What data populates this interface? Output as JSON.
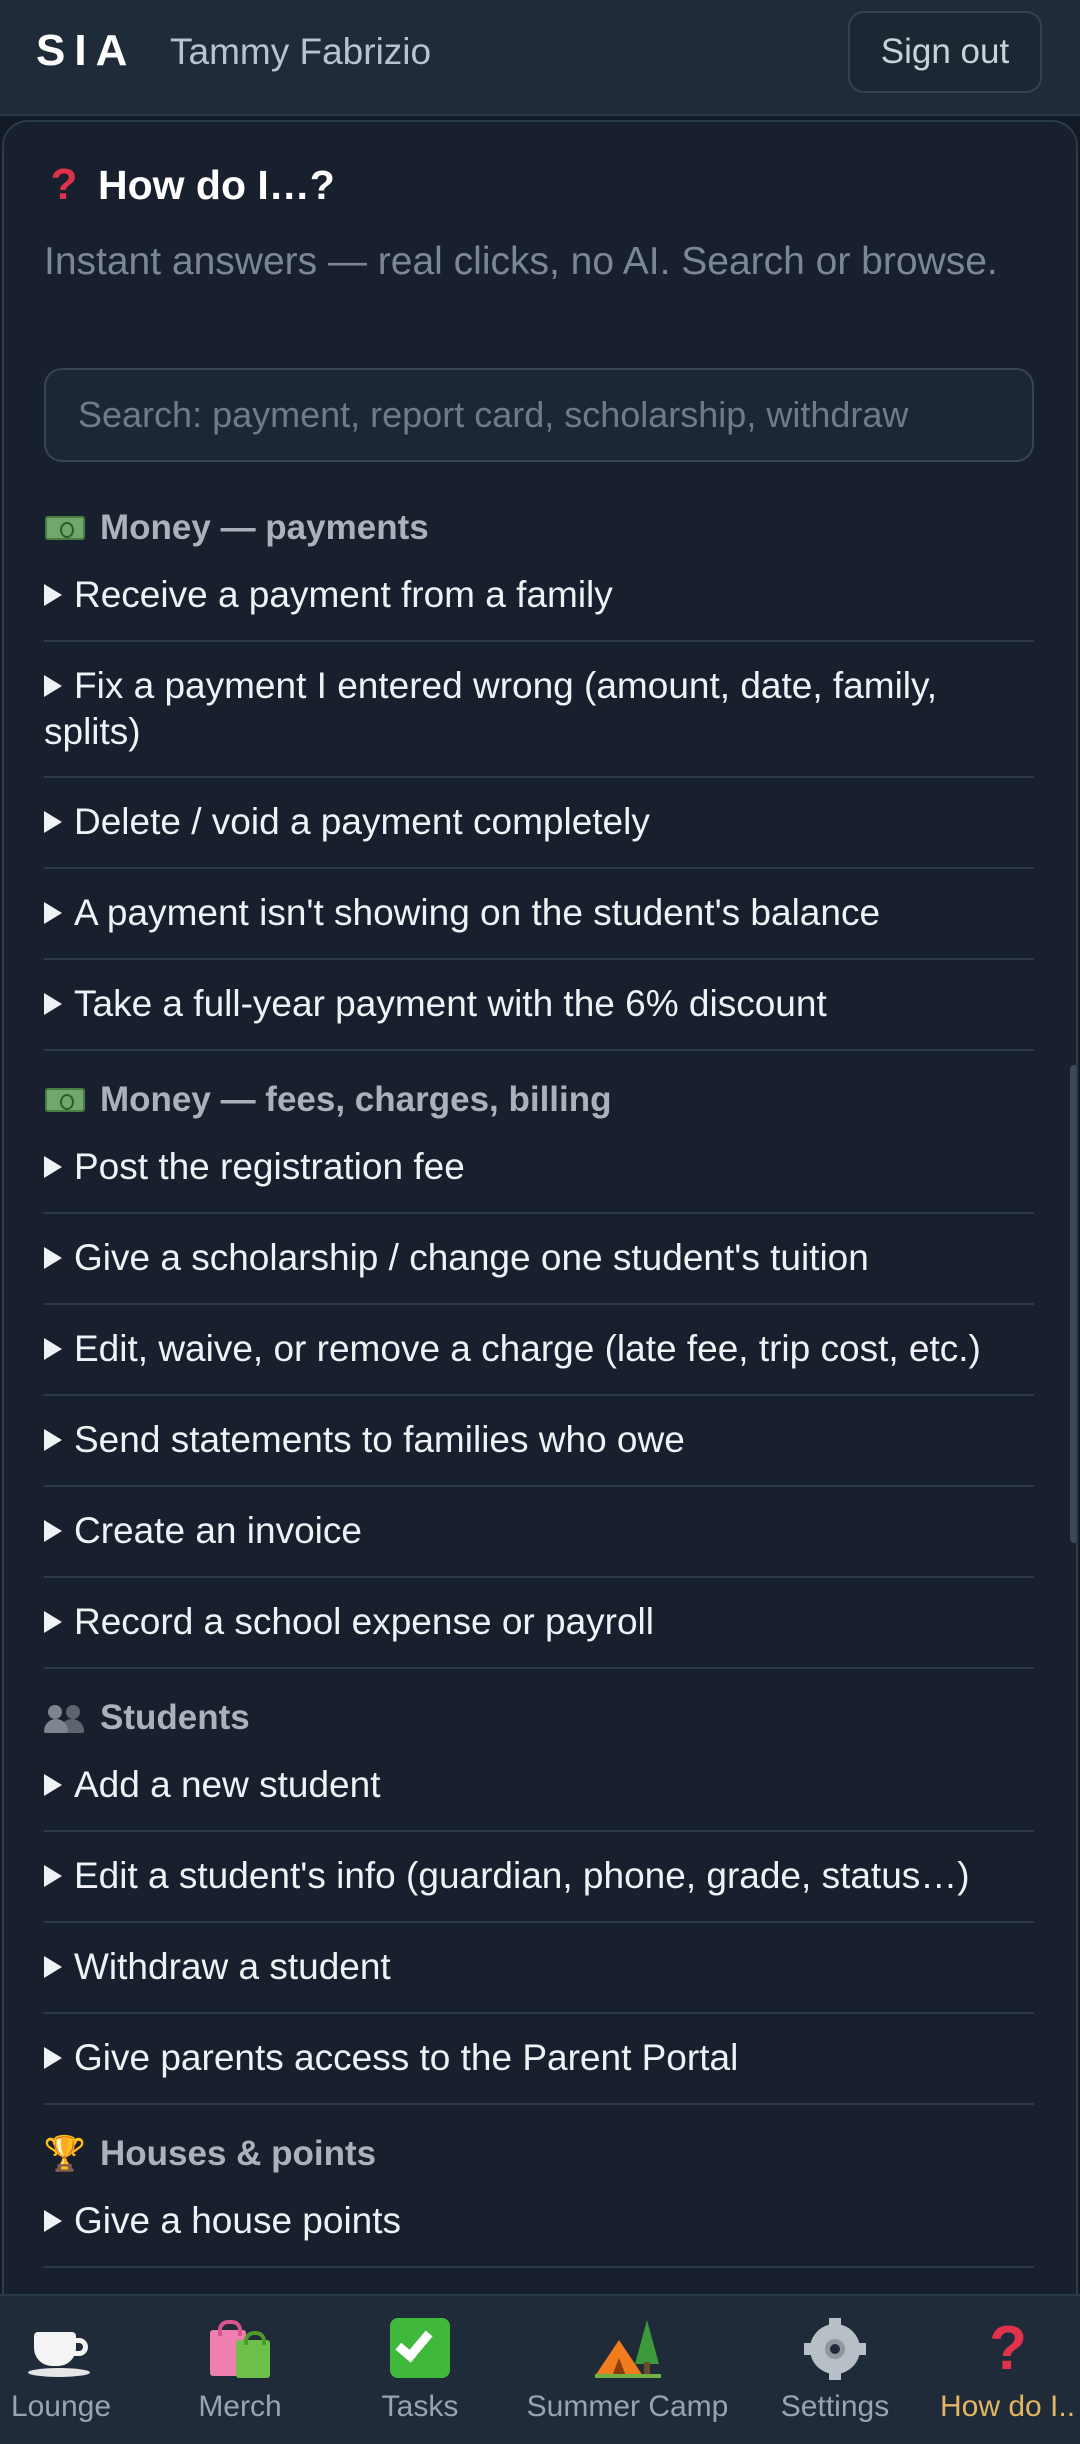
{
  "header": {
    "brand": "SIA",
    "user_name": "Tammy Fabrizio",
    "signout_label": "Sign out"
  },
  "help": {
    "icon": "question-icon",
    "title": "How do I…?",
    "subtitle": "Instant answers — real clicks, no AI. Search or browse.",
    "search_placeholder": "Search: payment, report card, scholarship, withdraw"
  },
  "sections": [
    {
      "icon": "money-icon",
      "title": "Money — payments",
      "items": [
        "Receive a payment from a family",
        "Fix a payment I entered wrong (amount, date, family, splits)",
        "Delete / void a payment completely",
        "A payment isn't showing on the student's balance",
        "Take a full-year payment with the 6% discount"
      ]
    },
    {
      "icon": "money-icon",
      "title": "Money — fees, charges, billing",
      "items": [
        "Post the registration fee",
        "Give a scholarship / change one student's tuition",
        "Edit, waive, or remove a charge (late fee, trip cost, etc.)",
        "Send statements to families who owe",
        "Create an invoice",
        "Record a school expense or payroll"
      ]
    },
    {
      "icon": "people-icon",
      "title": "Students",
      "items": [
        "Add a new student",
        "Edit a student's info (guardian, phone, grade, status…)",
        "Withdraw a student",
        "Give parents access to the Parent Portal"
      ]
    },
    {
      "icon": "trophy-icon",
      "title": "Houses & points",
      "items": [
        "Give a house points"
      ]
    }
  ],
  "nav": {
    "active": "How do I...",
    "tabs": [
      {
        "label": "Lounge",
        "icon": "coffee-cup-icon"
      },
      {
        "label": "Merch",
        "icon": "shopping-bags-icon"
      },
      {
        "label": "Tasks",
        "icon": "check-mark-icon"
      },
      {
        "label": "Summer Camp",
        "icon": "camping-icon"
      },
      {
        "label": "Settings",
        "icon": "gear-icon"
      },
      {
        "label": "How do I...",
        "icon": "question-icon"
      }
    ]
  },
  "colors": {
    "background": "#111a25",
    "panel": "#17202c",
    "accent_active": "#e5b562",
    "question_red": "#e0334b"
  }
}
